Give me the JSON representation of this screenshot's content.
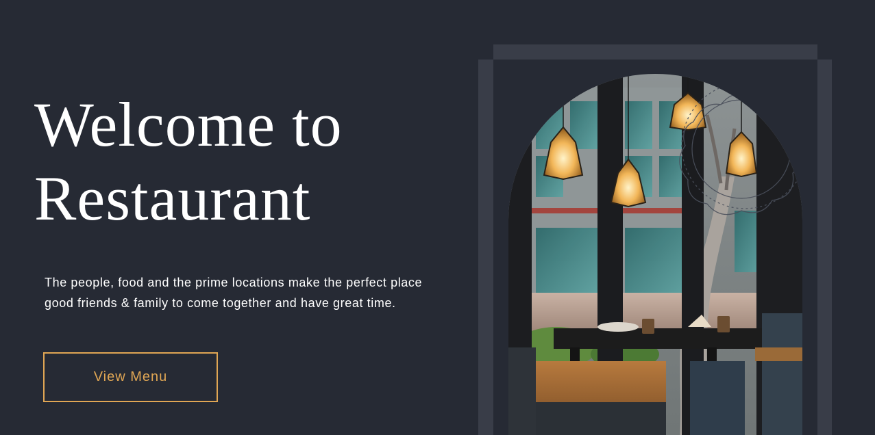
{
  "hero": {
    "title_line1": "Welcome to",
    "title_line2": "Restaurant",
    "description": "The people, food and the prime locations make the perfect place good friends & family to come together and have great time.",
    "cta_label": "View Menu"
  },
  "colors": {
    "background": "#262a34",
    "frame": "#393d48",
    "accent": "#e0a654",
    "text": "#ffffff"
  },
  "image": {
    "subject": "restaurant-interior-photo"
  }
}
